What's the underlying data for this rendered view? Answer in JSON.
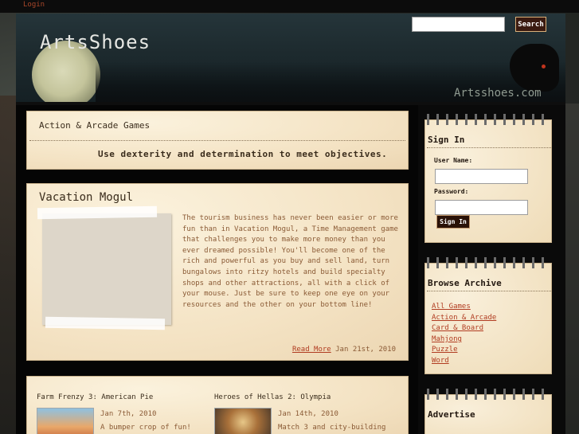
{
  "topbar": {
    "login_label": "Login"
  },
  "header": {
    "site_title": "ArtsShoes",
    "site_url": "Artsshoes.com",
    "search_button_label": "Search",
    "search_value": ""
  },
  "category": {
    "title": "Action & Arcade Games",
    "description": "Use dexterity and determination to meet objectives."
  },
  "post": {
    "title": "Vacation Mogul",
    "body": "The tourism business has never been easier or more fun than in Vacation Mogul, a Time Management game that challenges you to make more money than you ever dreamed possible! You'll become one of the rich and powerful as you buy and sell land, turn bungalows into ritzy hotels and build specialty shops and other attractions, all with a click of your mouse. Just be sure to keep one eye on your resources and the other on your bottom line!",
    "read_more_label": "Read More",
    "date": "Jan 21st, 2010"
  },
  "games": [
    {
      "title": "Farm Frenzy 3: American Pie",
      "date": "Jan 7th, 2010",
      "desc": "A bumper crop of fun!"
    },
    {
      "title": "Heroes of Hellas 2: Olympia",
      "date": "Jan 14th, 2010",
      "desc": "Match 3 and city-building"
    }
  ],
  "sidebar": {
    "signin": {
      "title": "Sign In",
      "username_label": "User Name:",
      "password_label": "Password:",
      "button_label": "Sign In"
    },
    "archive": {
      "title": "Browse Archive",
      "items": [
        "All Games",
        "Action & Arcade",
        "Card & Board",
        "Mahjong",
        "Puzzle",
        "Word"
      ]
    },
    "advertise": {
      "title": "Advertise"
    }
  },
  "icons": {
    "tick_glyph": "ʼ"
  },
  "colors": {
    "accent_link": "#b13c21",
    "paper": "#f7ead2",
    "button_dark": "#3a1a10"
  }
}
